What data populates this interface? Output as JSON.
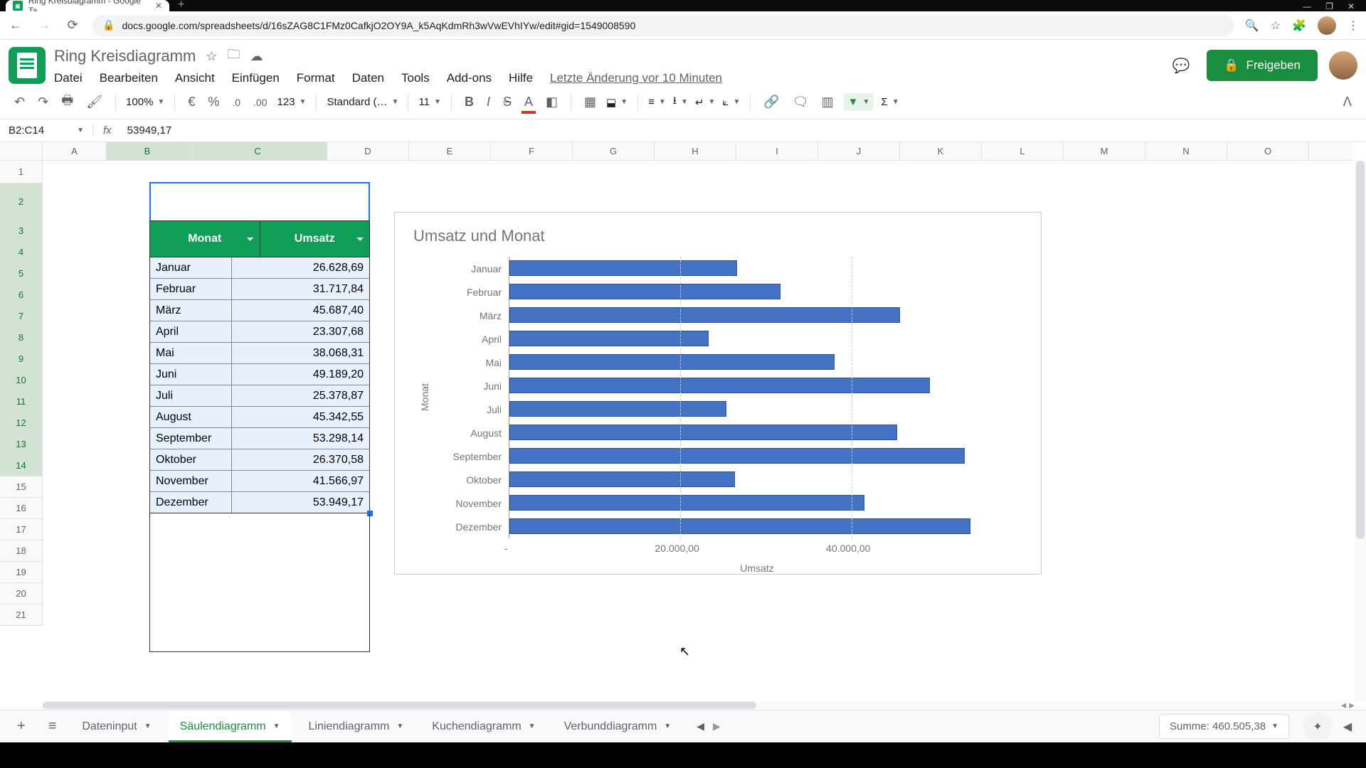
{
  "browser": {
    "tab_title": "Ring Kreisdiagramm - Google Ta",
    "url": "docs.google.com/spreadsheets/d/16sZAG8C1FMz0CafkjO2OY9A_k5AqKdmRh3wVwEVhIYw/edit#gid=1549008590"
  },
  "doc": {
    "title": "Ring Kreisdiagramm",
    "last_edit": "Letzte Änderung vor 10 Minuten"
  },
  "menu": {
    "file": "Datei",
    "edit": "Bearbeiten",
    "view": "Ansicht",
    "insert": "Einfügen",
    "format": "Format",
    "data": "Daten",
    "tools": "Tools",
    "addons": "Add-ons",
    "help": "Hilfe"
  },
  "share_label": "Freigeben",
  "toolbar": {
    "zoom": "100%",
    "currency": "€",
    "percent": "%",
    "dec_dec": ".0",
    "dec_inc": ".00",
    "num_format": "123",
    "font": "Standard (…",
    "font_size": "11"
  },
  "formula": {
    "cell_ref": "B2:C14",
    "value": "53949,17"
  },
  "columns": [
    "A",
    "B",
    "C",
    "D",
    "E",
    "F",
    "G",
    "H",
    "I",
    "J",
    "K",
    "L",
    "M",
    "N",
    "O"
  ],
  "rows": [
    "1",
    "2",
    "3",
    "4",
    "5",
    "6",
    "7",
    "8",
    "9",
    "10",
    "11",
    "12",
    "13",
    "14",
    "15",
    "16",
    "17",
    "18",
    "19",
    "20",
    "21"
  ],
  "table": {
    "header_month": "Monat",
    "header_value": "Umsatz",
    "rows": [
      {
        "month": "Januar",
        "value": "26.628,69"
      },
      {
        "month": "Februar",
        "value": "31.717,84"
      },
      {
        "month": "März",
        "value": "45.687,40"
      },
      {
        "month": "April",
        "value": "23.307,68"
      },
      {
        "month": "Mai",
        "value": "38.068,31"
      },
      {
        "month": "Juni",
        "value": "49.189,20"
      },
      {
        "month": "Juli",
        "value": "25.378,87"
      },
      {
        "month": "August",
        "value": "45.342,55"
      },
      {
        "month": "September",
        "value": "53.298,14"
      },
      {
        "month": "Oktober",
        "value": "26.370,58"
      },
      {
        "month": "November",
        "value": "41.566,97"
      },
      {
        "month": "Dezember",
        "value": "53.949,17"
      }
    ]
  },
  "chart_data": {
    "type": "bar",
    "orientation": "horizontal",
    "title": "Umsatz und Monat",
    "xlabel": "Umsatz",
    "ylabel": "Monat",
    "xlim": [
      0,
      60000
    ],
    "x_ticks": [
      {
        "pos": 0,
        "label": "-"
      },
      {
        "pos": 20000,
        "label": "20.000,00"
      },
      {
        "pos": 40000,
        "label": "40.000,00"
      }
    ],
    "categories": [
      "Januar",
      "Februar",
      "März",
      "April",
      "Mai",
      "Juni",
      "Juli",
      "August",
      "September",
      "Oktober",
      "November",
      "Dezember"
    ],
    "values": [
      26628.69,
      31717.84,
      45687.4,
      23307.68,
      38068.31,
      49189.2,
      25378.87,
      45342.55,
      53298.14,
      26370.58,
      41566.97,
      53949.17
    ]
  },
  "sheets": {
    "s0": "Dateninput",
    "s1": "Säulendiagramm",
    "s2": "Liniendiagramm",
    "s3": "Kuchendiagramm",
    "s4": "Verbunddiagramm"
  },
  "aggregate": "Summe: 460.505,38"
}
